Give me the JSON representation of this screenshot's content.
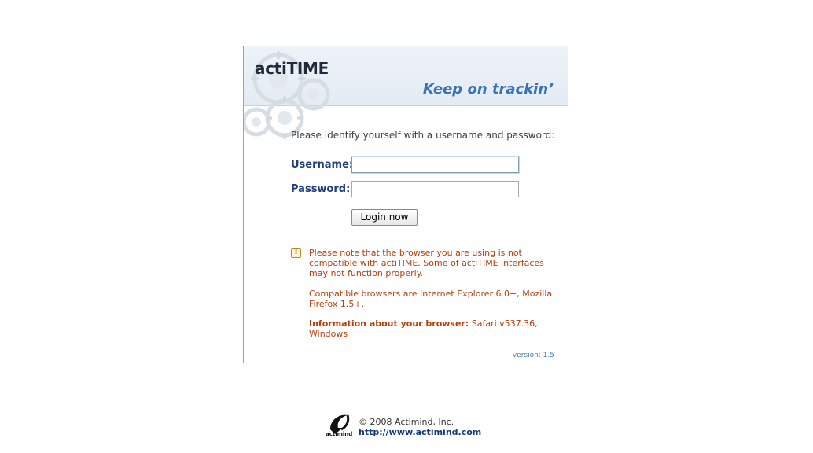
{
  "header": {
    "logo_text": "actiTIME",
    "tagline": "Keep on trackin’"
  },
  "form": {
    "prompt": "Please identify yourself with a username and password:",
    "username_label": "Username:",
    "username_value": "",
    "password_label": "Password:",
    "password_value": "",
    "login_button_label": "Login now"
  },
  "warning": {
    "icon": "warning-icon",
    "message": "Please note that the browser you are using is not compatible with actiTIME. Some of actiTIME interfaces may not function properly.",
    "compatible": "Compatible browsers are Internet Explorer 6.0+, Mozilla Firefox 1.5+.",
    "browser_info_label": "Information about your browser:",
    "browser_info_value": "Safari v537.36, Windows"
  },
  "version": "version: 1.5",
  "footer": {
    "logo_text": "actimind",
    "copyright": "© 2008 Actimind, Inc.",
    "link": "http://www.actimind.com"
  },
  "colors": {
    "accent": "#3a72b8",
    "label": "#1f3d7a",
    "warning": "#b1400e",
    "border": "#8aa6c7"
  }
}
